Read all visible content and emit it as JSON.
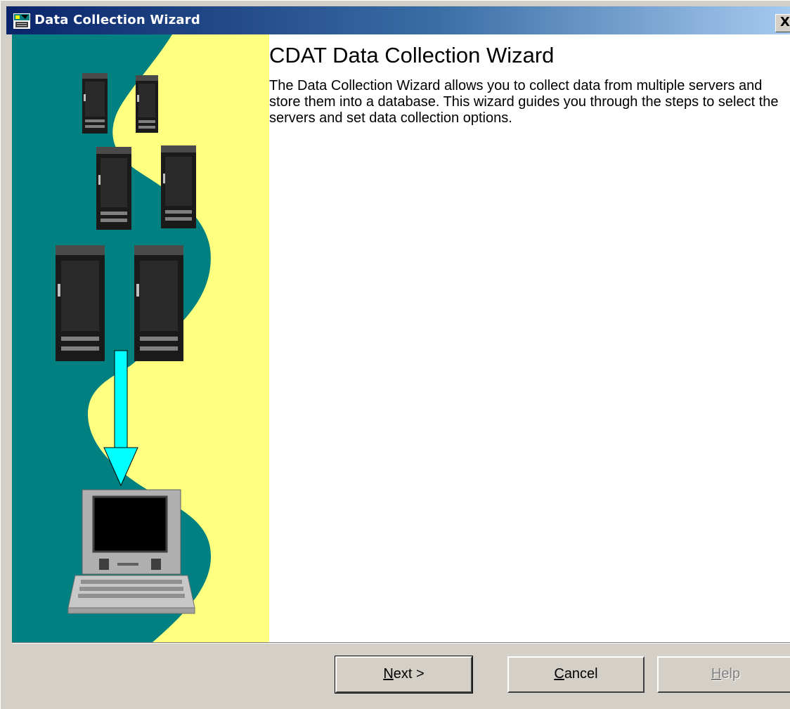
{
  "window": {
    "title": "Data Collection Wizard",
    "close_label": "X"
  },
  "page": {
    "heading": "CDAT Data Collection Wizard",
    "description": "The Data Collection Wizard allows you to collect data from multiple servers and store them into a database. This wizard guides you through the steps to select the servers and set data collection options."
  },
  "buttons": {
    "next": {
      "mnemonic": "N",
      "rest": "ext >"
    },
    "cancel": {
      "mnemonic": "C",
      "rest": "ancel"
    },
    "help": {
      "mnemonic": "H",
      "rest": "elp",
      "enabled": false
    }
  },
  "colors": {
    "titlebar_start": "#0a246a",
    "titlebar_end": "#a6caf0",
    "art_teal": "#008080",
    "art_yellow": "#ffff80",
    "arrow": "#00ffff",
    "dialog_bg": "#d4d0c8"
  },
  "icons": [
    "app-icon",
    "server-icon",
    "down-arrow-icon",
    "laptop-icon",
    "close-icon"
  ]
}
